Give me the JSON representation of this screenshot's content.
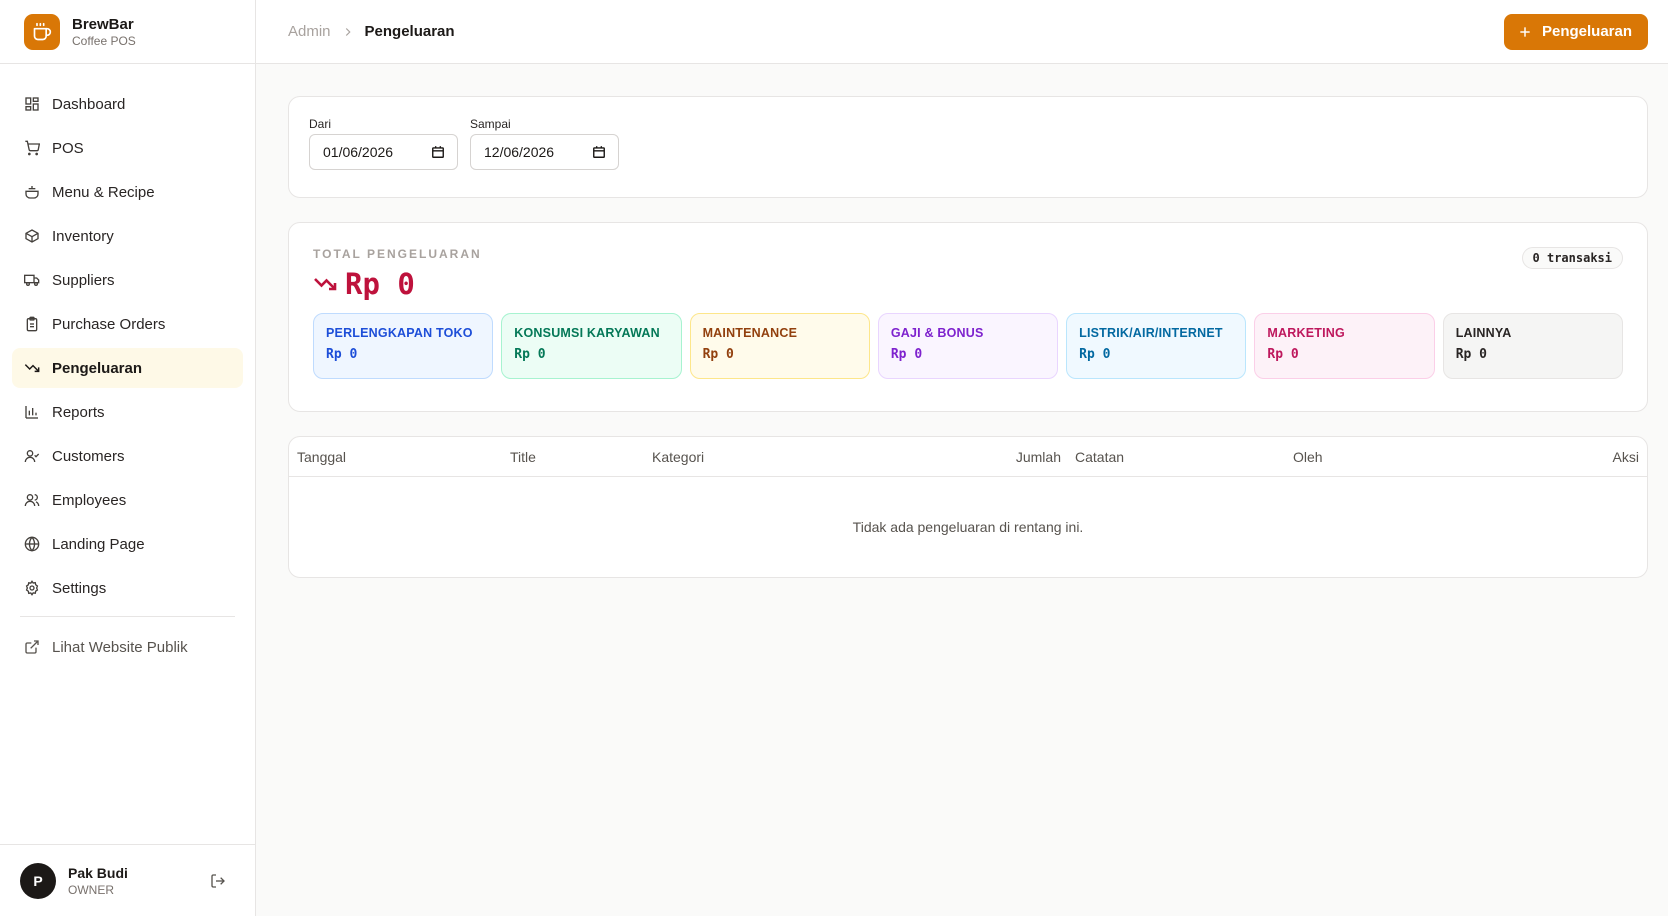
{
  "brand": {
    "name": "BrewBar",
    "subtitle": "Coffee POS",
    "icon": "coffee-cup-icon",
    "color": "#d97706"
  },
  "nav": {
    "items": [
      {
        "label": "Dashboard",
        "icon": "dashboard-icon",
        "active": false
      },
      {
        "label": "POS",
        "icon": "cart-icon",
        "active": false
      },
      {
        "label": "Menu & Recipe",
        "icon": "menu-icon",
        "active": false
      },
      {
        "label": "Inventory",
        "icon": "box-icon",
        "active": false
      },
      {
        "label": "Suppliers",
        "icon": "truck-icon",
        "active": false
      },
      {
        "label": "Purchase Orders",
        "icon": "clipboard-icon",
        "active": false
      },
      {
        "label": "Pengeluaran",
        "icon": "trending-down-icon",
        "active": true
      },
      {
        "label": "Reports",
        "icon": "bar-chart-icon",
        "active": false
      },
      {
        "label": "Customers",
        "icon": "user-icon",
        "active": false
      },
      {
        "label": "Employees",
        "icon": "users-icon",
        "active": false
      },
      {
        "label": "Landing Page",
        "icon": "globe-icon",
        "active": false
      },
      {
        "label": "Settings",
        "icon": "gear-icon",
        "active": false
      }
    ],
    "public_link": {
      "label": "Lihat Website Publik",
      "icon": "external-link-icon"
    }
  },
  "user": {
    "initial": "P",
    "name": "Pak Budi",
    "role": "OWNER"
  },
  "breadcrumb": {
    "root": "Admin",
    "current": "Pengeluaran"
  },
  "header": {
    "add_label": "Pengeluaran"
  },
  "filter": {
    "from_label": "Dari",
    "from_value": "01/06/2026",
    "to_label": "Sampai",
    "to_value": "12/06/2026"
  },
  "summary": {
    "label": "TOTAL PENGELUARAN",
    "value": "Rp 0",
    "tx_count": "0 transaksi",
    "accent": "#be123c",
    "categories": [
      {
        "name": "PERLENGKAPAN TOKO",
        "value": "Rp 0",
        "text": "#1d4ed8",
        "bg": "#eff6ff",
        "border": "#bfdbfe"
      },
      {
        "name": "KONSUMSI KARYAWAN",
        "value": "Rp 0",
        "text": "#047857",
        "bg": "#ecfdf5",
        "border": "#a7f3d0"
      },
      {
        "name": "MAINTENANCE",
        "value": "Rp 0",
        "text": "#92400e",
        "bg": "#fffbeb",
        "border": "#fde68a"
      },
      {
        "name": "GAJI & BONUS",
        "value": "Rp 0",
        "text": "#7e22ce",
        "bg": "#faf5ff",
        "border": "#e9d5ff"
      },
      {
        "name": "LISTRIK/AIR/INTERNET",
        "value": "Rp 0",
        "text": "#0369a1",
        "bg": "#f0f9ff",
        "border": "#bae6fd"
      },
      {
        "name": "MARKETING",
        "value": "Rp 0",
        "text": "#be185d",
        "bg": "#fdf2f8",
        "border": "#fbcfe8"
      },
      {
        "name": "LAINNYA",
        "value": "Rp 0",
        "text": "#292524",
        "bg": "#f5f5f4",
        "border": "#e7e5e4"
      }
    ]
  },
  "table": {
    "columns": [
      "Tanggal",
      "Title",
      "Kategori",
      "Jumlah",
      "Catatan",
      "Oleh",
      "Aksi"
    ],
    "empty_text": "Tidak ada pengeluaran di rentang ini."
  }
}
